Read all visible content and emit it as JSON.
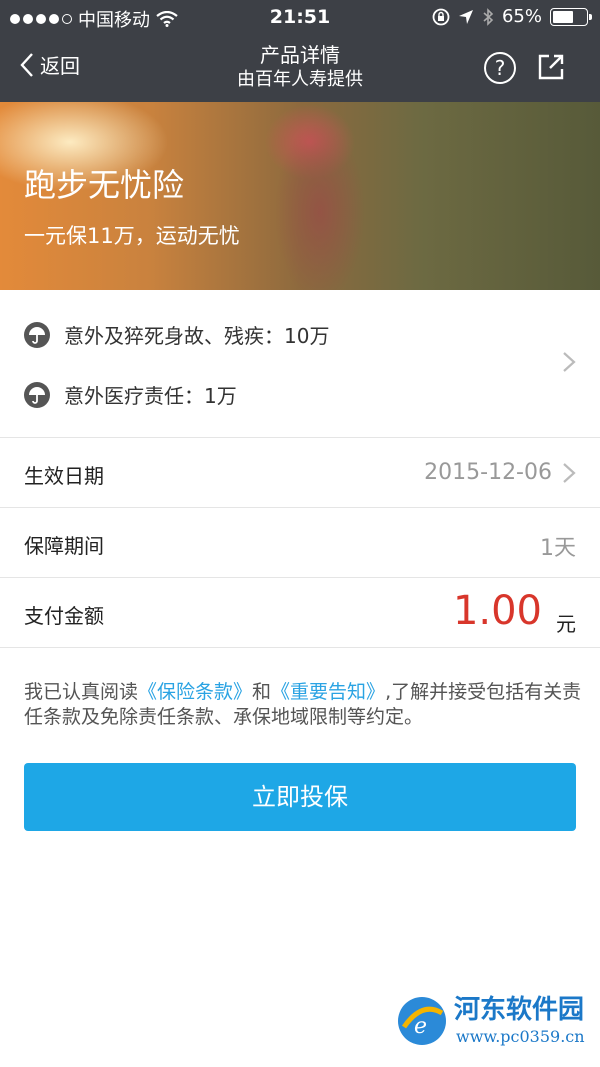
{
  "status_bar": {
    "carrier": "中国移动",
    "time": "21:51",
    "battery_percent": "65%",
    "battery_level": 0.65,
    "icons": [
      "signal-dots-icon",
      "wifi-icon",
      "rotation-lock-icon",
      "location-icon",
      "bluetooth-icon",
      "battery-icon"
    ]
  },
  "nav": {
    "back_label": "返回",
    "title": "产品详情",
    "subtitle": "由百年人寿提供",
    "help_icon": "question-circle-icon",
    "share_icon": "share-icon"
  },
  "banner": {
    "product_name": "跑步无忧险",
    "tagline": "一元保11万，运动无忧"
  },
  "coverage": {
    "items": [
      {
        "icon": "umbrella-icon",
        "label": "意外及猝死身故、残疾：10万"
      },
      {
        "icon": "umbrella-icon",
        "label": "意外医疗责任：1万"
      }
    ]
  },
  "details": {
    "effective_date_label": "生效日期",
    "effective_date_value": "2015-12-06",
    "period_label": "保障期间",
    "period_value": "1天",
    "payment_label": "支付金额",
    "payment_value": "1.00",
    "payment_unit": "元"
  },
  "agreement": {
    "prefix": "我已认真阅读",
    "link1": "《保险条款》",
    "and": "和",
    "link2": "《重要告知》",
    "suffix": ",了解并接受包括有关责任条款及免除责任条款、承保地域限制等约定。"
  },
  "cta": {
    "label": "立即投保"
  },
  "watermark": {
    "name": "河东软件园",
    "url": "www.pc0359.cn"
  },
  "colors": {
    "nav_bg": "#3d4046",
    "accent_blue": "#1ea7e6",
    "link_blue": "#2aa3e3",
    "price_red": "#d8362b"
  }
}
